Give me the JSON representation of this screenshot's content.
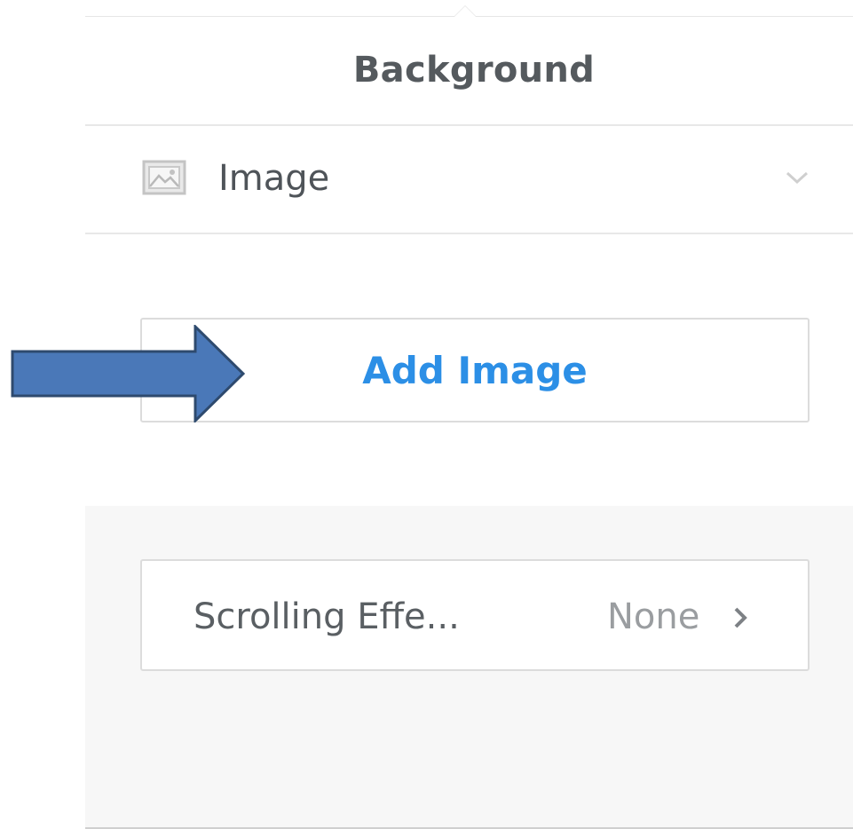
{
  "panel": {
    "title": "Background"
  },
  "background_type": {
    "icon": "image-icon",
    "label": "Image",
    "dropdown_icon": "chevron-down-icon"
  },
  "add_image": {
    "label": "Add Image"
  },
  "scrolling_effect": {
    "label": "Scrolling Effe...",
    "value": "None",
    "icon": "chevron-right-icon"
  },
  "colors": {
    "accent": "#2c8fe6",
    "arrow_fill": "#4a78b8",
    "arrow_stroke": "#2e4a6e",
    "section_bg": "#f7f7f7"
  }
}
